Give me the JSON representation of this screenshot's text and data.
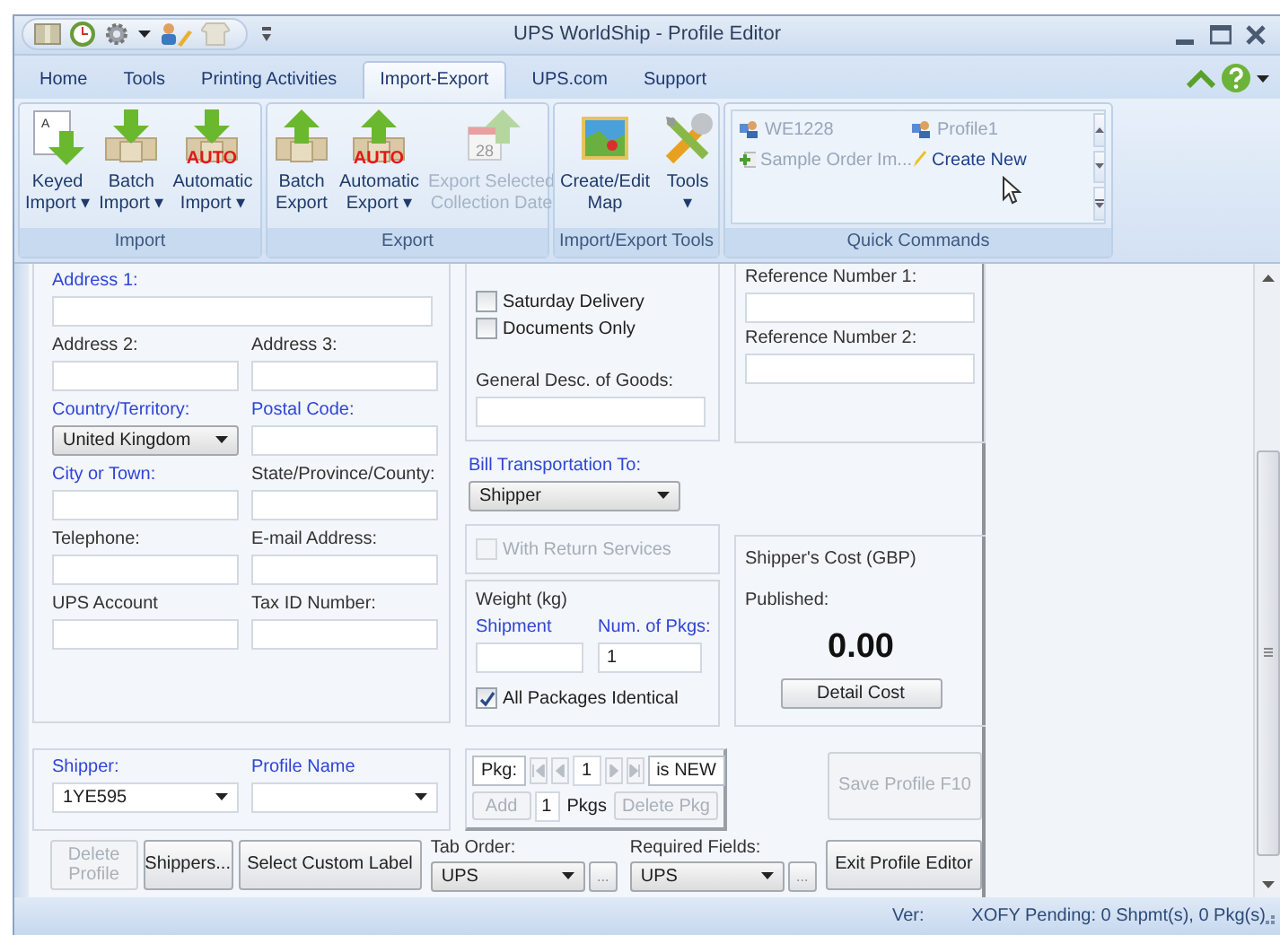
{
  "window": {
    "title": "UPS WorldShip  -  Profile Editor"
  },
  "tabs": [
    {
      "label": "Home",
      "selected": false
    },
    {
      "label": "Tools",
      "selected": false
    },
    {
      "label": "Printing Activities",
      "selected": false
    },
    {
      "label": "Import-Export",
      "selected": true
    },
    {
      "label": "UPS.com",
      "selected": false
    },
    {
      "label": "Support",
      "selected": false
    }
  ],
  "ribbon_groups": [
    {
      "label": "Import",
      "buttons": [
        {
          "lines": [
            "Keyed",
            "Import ▾"
          ],
          "icon_text": "A",
          "disabled": false
        },
        {
          "lines": [
            "Batch",
            "Import ▾"
          ],
          "disabled": false
        },
        {
          "lines": [
            "Automatic",
            "Import ▾"
          ],
          "icon_text": "AUTO",
          "disabled": false
        }
      ]
    },
    {
      "label": "Export",
      "buttons": [
        {
          "lines": [
            "Batch",
            "Export"
          ],
          "disabled": false
        },
        {
          "lines": [
            "Automatic",
            "Export ▾"
          ],
          "icon_text": "AUTO",
          "disabled": false
        },
        {
          "lines": [
            "Export Selected",
            "Collection Date"
          ],
          "icon_text": "28",
          "disabled": true
        }
      ]
    },
    {
      "label": "Import/Export Tools",
      "buttons": [
        {
          "lines": [
            "Create/Edit",
            "Map"
          ],
          "disabled": false
        },
        {
          "lines": [
            "Tools",
            "▾"
          ],
          "disabled": false
        }
      ]
    }
  ],
  "quick_commands": {
    "label": "Quick Commands",
    "items": [
      {
        "label": "WE1228",
        "disabled": true
      },
      {
        "label": "Profile1",
        "disabled": true
      },
      {
        "label": "Sample Order Im...",
        "disabled": true
      },
      {
        "label": "Create New",
        "disabled": false
      }
    ]
  },
  "address_fields": [
    {
      "label": "Address 1:",
      "required": true,
      "kind": "text",
      "wide": true
    },
    {
      "label": "Address 2:",
      "required": false,
      "kind": "text"
    },
    {
      "label": "Address 3:",
      "required": false,
      "kind": "text"
    },
    {
      "label": "Country/Territory:",
      "required": true,
      "kind": "select",
      "value": "United Kingdom"
    },
    {
      "label": "Postal Code:",
      "required": true,
      "kind": "text"
    },
    {
      "label": "City or Town:",
      "required": true,
      "kind": "text"
    },
    {
      "label": "State/Province/County:",
      "required": false,
      "kind": "text"
    },
    {
      "label": "Telephone:",
      "required": false,
      "kind": "text"
    },
    {
      "label": "E-mail Address:",
      "required": false,
      "kind": "text"
    },
    {
      "label": "UPS Account",
      "required": false,
      "kind": "text"
    },
    {
      "label": "Tax ID Number:",
      "required": false,
      "kind": "text"
    }
  ],
  "options": [
    {
      "label": "Saturday Delivery",
      "checked": false,
      "disabled": false
    },
    {
      "label": "Documents Only",
      "checked": false,
      "disabled": false
    }
  ],
  "goods_description": {
    "label": "General Desc. of Goods:",
    "required": false
  },
  "references": [
    {
      "label": "Reference Number 1:",
      "required": false
    },
    {
      "label": "Reference Number 2:",
      "required": false
    }
  ],
  "bill_to": {
    "label": "Bill Transportation To:",
    "required": true,
    "value": "Shipper"
  },
  "return_services": {
    "label": "With Return Services",
    "checked": false,
    "disabled": true
  },
  "weight": {
    "title": "Weight (kg)",
    "fields": [
      {
        "label": "Shipment",
        "required": true
      },
      {
        "label": "Num. of Pkgs:",
        "required": true,
        "value": "1"
      }
    ],
    "identical": {
      "label": "All Packages Identical",
      "checked": true,
      "disabled": false
    }
  },
  "cost": {
    "title": "Shipper's Cost (GBP)",
    "label": "Published:",
    "amount": "0.00",
    "button": "Detail Cost"
  },
  "shipper_fields": [
    {
      "label": "Shipper:",
      "required": true,
      "value": "1YE595"
    },
    {
      "label": "Profile Name",
      "required": true
    }
  ],
  "package_nav": {
    "label": "Pkg:",
    "current": "1",
    "state": "is NEW",
    "nav": [
      {
        "kind": "first",
        "disabled": true
      },
      {
        "kind": "prev",
        "disabled": true
      },
      {
        "kind": "next",
        "disabled": true
      },
      {
        "kind": "last",
        "disabled": true
      }
    ],
    "add_button": {
      "label": "Add",
      "disabled": true
    },
    "count": "1",
    "count_unit": "Pkgs",
    "delete_button": {
      "label": "Delete Pkg",
      "disabled": true
    }
  },
  "save_button": {
    "label": "Save Profile F10",
    "disabled": true
  },
  "bottom_buttons": [
    {
      "lines": [
        "Delete",
        "Profile"
      ],
      "disabled": true
    },
    {
      "lines": [
        "Shippers..."
      ],
      "disabled": false
    },
    {
      "lines": [
        "Select Custom Label"
      ],
      "disabled": false
    }
  ],
  "selectors": [
    {
      "label": "Tab Order:",
      "value": "UPS",
      "more": "..."
    },
    {
      "label": "Required Fields:",
      "value": "UPS",
      "more": "..."
    }
  ],
  "exit_button": {
    "label": "Exit Profile Editor",
    "disabled": false
  },
  "status_bar": {
    "version_label": "Ver:",
    "pending": "XOFY Pending: 0 Shpmt(s), 0 Pkg(s)"
  }
}
